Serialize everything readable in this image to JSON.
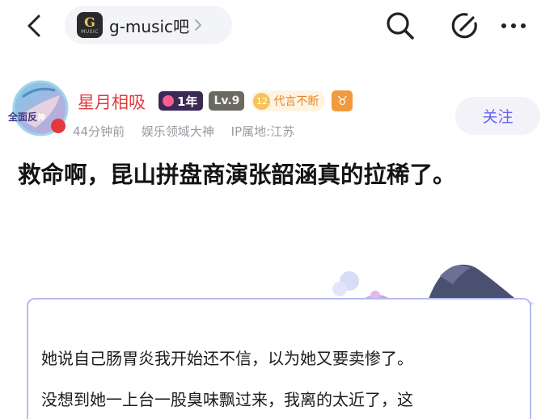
{
  "header": {
    "forum_logo_text": "G",
    "forum_logo_subtext": "MUSIC",
    "forum_name": "g-music吧",
    "icons": [
      "back-arrow-icon",
      "chevron-right-icon",
      "search-icon",
      "edit-icon",
      "more-dots-icon"
    ]
  },
  "author": {
    "name": "星月相吸",
    "avatar_badge": "全面反",
    "avatar_badge_2": "神",
    "badges": {
      "year": "1年",
      "level": "Lv.9",
      "speak_num": "12",
      "speak_label": "代言不断",
      "zodiac": "♉"
    },
    "time": "44分钟前",
    "title": "娱乐领域大神",
    "ip": "IP属地:江苏",
    "follow_label": "关注"
  },
  "post": {
    "title": "救命啊，昆山拼盘商演张韶涵真的拉稀了。",
    "quote_lines": [
      "她说自己肠胃炎我开始还不信，以为她又要卖惨了。",
      "没想到她一上台一股臭味飘过来，我离的太近了，这"
    ]
  },
  "colors": {
    "author_name": "#e4393c",
    "follow_text": "#6461f5",
    "quote_border": "#b8bbf0",
    "meta": "#9a9aa2"
  }
}
